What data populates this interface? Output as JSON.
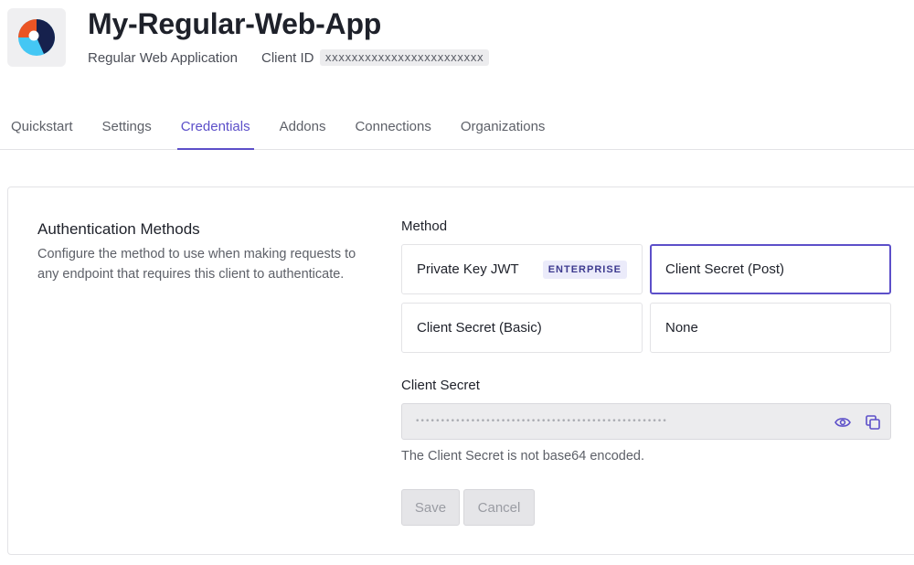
{
  "app": {
    "title": "My-Regular-Web-App",
    "type": "Regular Web Application",
    "client_id_label": "Client ID",
    "client_id_value": "xxxxxxxxxxxxxxxxxxxxxxxx"
  },
  "tabs": [
    {
      "label": "Quickstart",
      "active": false
    },
    {
      "label": "Settings",
      "active": false
    },
    {
      "label": "Credentials",
      "active": true
    },
    {
      "label": "Addons",
      "active": false
    },
    {
      "label": "Connections",
      "active": false
    },
    {
      "label": "Organizations",
      "active": false
    }
  ],
  "auth": {
    "title": "Authentication Methods",
    "description": "Configure the method to use when making requests to any endpoint that requires this client to authenticate.",
    "method_label": "Method",
    "methods": [
      {
        "label": "Private Key JWT",
        "badge": "ENTERPRISE",
        "selected": false
      },
      {
        "label": "Client Secret (Post)",
        "selected": true
      },
      {
        "label": "Client Secret (Basic)",
        "selected": false
      },
      {
        "label": "None",
        "selected": false
      }
    ],
    "secret_label": "Client Secret",
    "secret_mask": "••••••••••••••••••••••••••••••••••••••••••••••••••",
    "secret_help": "The Client Secret is not base64 encoded.",
    "save_label": "Save",
    "cancel_label": "Cancel"
  },
  "colors": {
    "accent": "#5c4fc9",
    "badge_bg": "#ebebfa",
    "logo_orange": "#eb5424",
    "logo_navy": "#16214d",
    "logo_blue": "#44c7f4"
  }
}
